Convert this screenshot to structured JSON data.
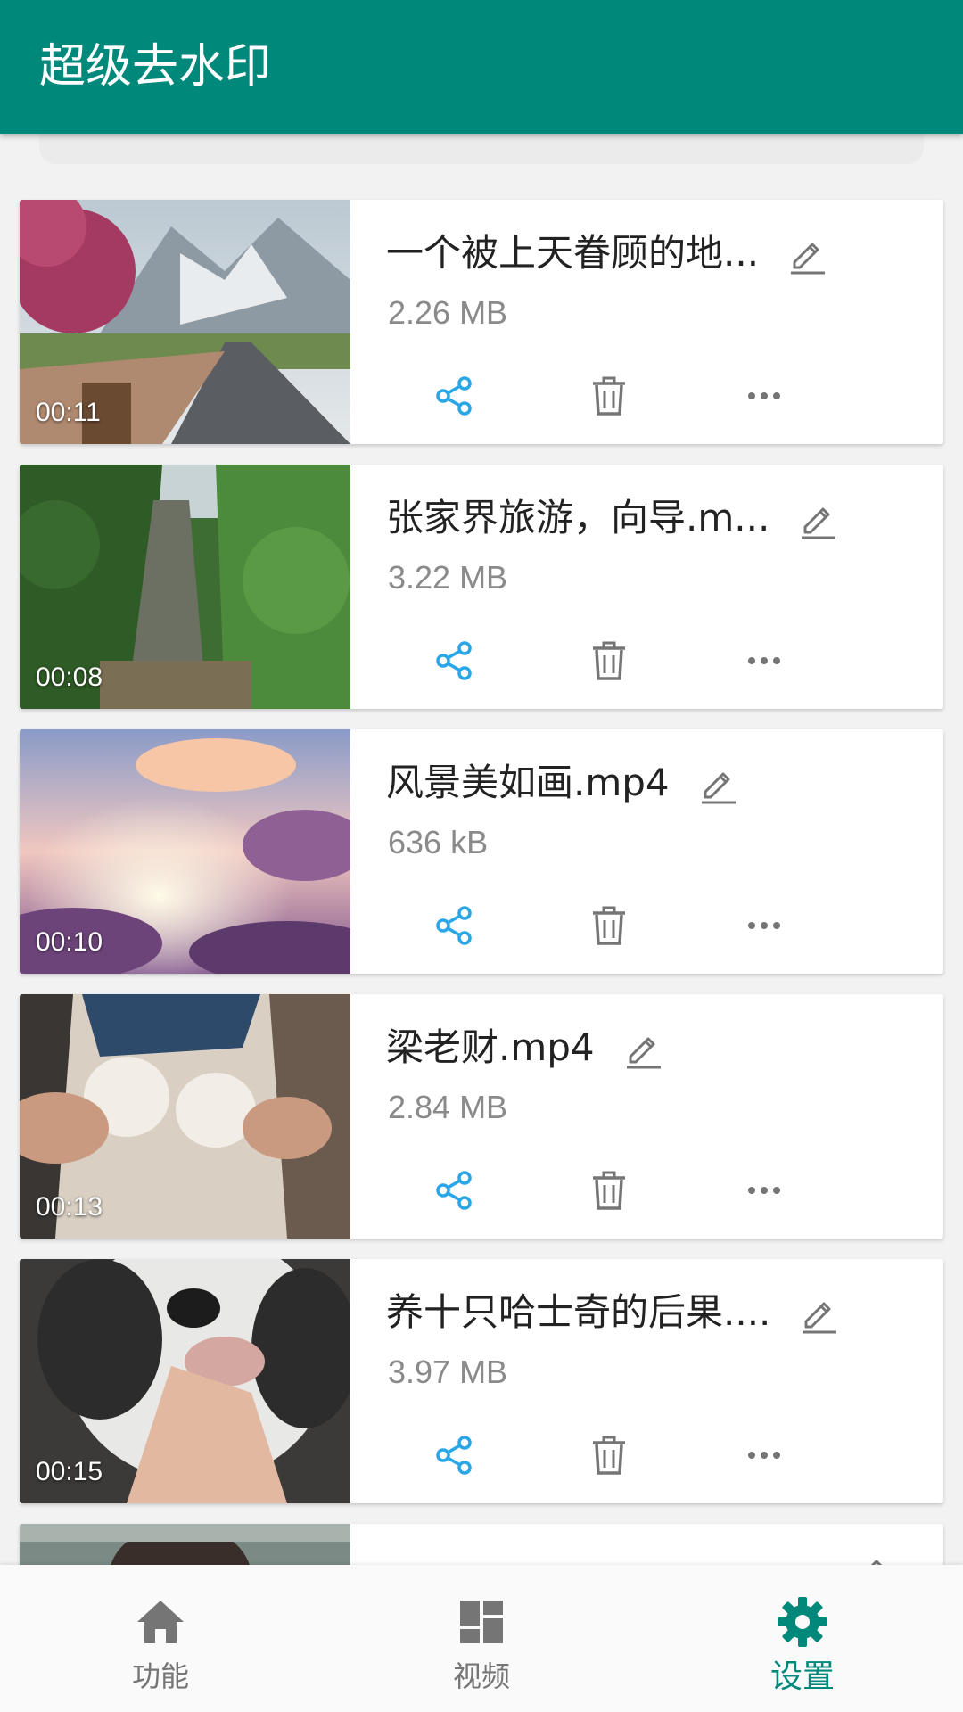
{
  "app_bar": {
    "title": "超级去水印"
  },
  "videos": [
    {
      "title": "一个被上天眷顾的地...",
      "size": "2.26 MB",
      "duration": "00:11"
    },
    {
      "title": "张家界旅游，向导.m...",
      "size": "3.22 MB",
      "duration": "00:08"
    },
    {
      "title": "风景美如画.mp4",
      "size": "636 kB",
      "duration": "00:10"
    },
    {
      "title": "梁老财.mp4",
      "size": "2.84 MB",
      "duration": "00:13"
    },
    {
      "title": "养十只哈士奇的后果....",
      "size": "3.97 MB",
      "duration": "00:15"
    }
  ],
  "bottom_nav": {
    "items": [
      {
        "label": "功能",
        "icon": "home-icon"
      },
      {
        "label": "视频",
        "icon": "dashboard-icon"
      },
      {
        "label": "设置",
        "icon": "gear-icon",
        "active": true
      }
    ]
  },
  "colors": {
    "primary": "#00897b",
    "action_blue": "#29a6e8",
    "icon_grey": "#757575"
  }
}
